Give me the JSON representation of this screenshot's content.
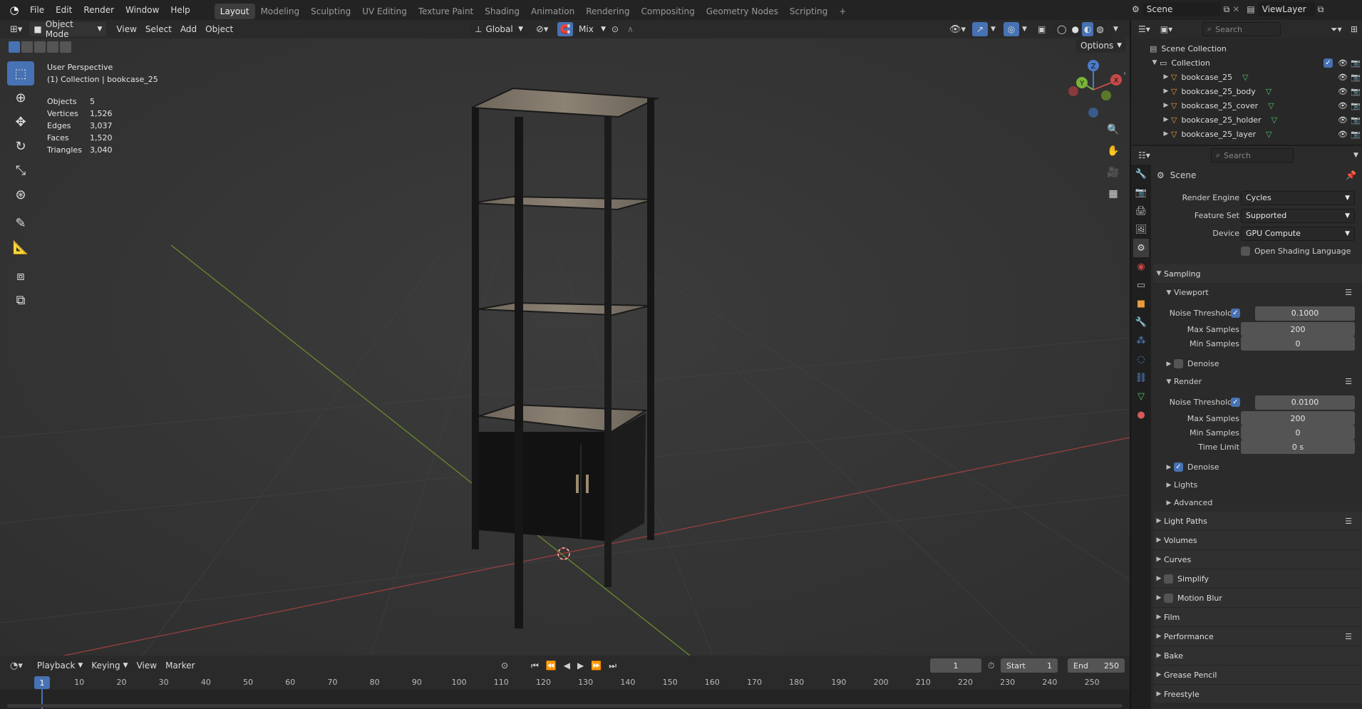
{
  "menu": [
    "File",
    "Edit",
    "Render",
    "Window",
    "Help"
  ],
  "workspaces": [
    "Layout",
    "Modeling",
    "Sculpting",
    "UV Editing",
    "Texture Paint",
    "Shading",
    "Animation",
    "Rendering",
    "Compositing",
    "Geometry Nodes",
    "Scripting"
  ],
  "active_workspace": "Layout",
  "scene_name": "Scene",
  "view_layer": "ViewLayer",
  "viewport_header": {
    "mode": "Object Mode",
    "view": "View",
    "select": "Select",
    "add": "Add",
    "object": "Object",
    "transform": "Global",
    "snap_mode": "Mix",
    "options": "Options"
  },
  "viewport_info": {
    "perspective": "User Perspective",
    "collection": "(1) Collection | bookcase_25"
  },
  "stats": [
    {
      "k": "Objects",
      "v": "5"
    },
    {
      "k": "Vertices",
      "v": "1,526"
    },
    {
      "k": "Edges",
      "v": "3,037"
    },
    {
      "k": "Faces",
      "v": "1,520"
    },
    {
      "k": "Triangles",
      "v": "3,040"
    }
  ],
  "gizmo": {
    "z": "Z",
    "y": "Y",
    "x": "X"
  },
  "outliner": {
    "search_placeholder": "Search",
    "root": "Scene Collection",
    "collection": "Collection",
    "objects": [
      "bookcase_25",
      "bookcase_25_body",
      "bookcase_25_cover",
      "bookcase_25_holder",
      "bookcase_25_layer"
    ]
  },
  "properties": {
    "search_placeholder": "Search",
    "context": "Scene",
    "render_engine_label": "Render Engine",
    "render_engine": "Cycles",
    "feature_set_label": "Feature Set",
    "feature_set": "Supported",
    "device_label": "Device",
    "device": "GPU Compute",
    "osl_label": "Open Shading Language",
    "sampling": "Sampling",
    "viewport": "Viewport",
    "noise_threshold_label": "Noise Threshold",
    "vp_noise": "0.1000",
    "max_samples_label": "Max Samples",
    "vp_max": "200",
    "min_samples_label": "Min Samples",
    "vp_min": "0",
    "denoise_label": "Denoise",
    "render": "Render",
    "r_noise": "0.0100",
    "r_max": "200",
    "r_min": "0",
    "time_limit_label": "Time Limit",
    "r_time": "0 s",
    "lights": "Lights",
    "advanced": "Advanced",
    "sections": [
      "Light Paths",
      "Volumes",
      "Curves",
      "Simplify",
      "Motion Blur",
      "Film",
      "Performance",
      "Bake",
      "Grease Pencil",
      "Freestyle"
    ]
  },
  "timeline": {
    "playback": "Playback",
    "keying": "Keying",
    "view": "View",
    "marker": "Marker",
    "current": "1",
    "start_label": "Start",
    "start": "1",
    "end_label": "End",
    "end": "250",
    "ticks": [
      "1",
      "10",
      "20",
      "30",
      "40",
      "50",
      "60",
      "70",
      "80",
      "90",
      "100",
      "110",
      "120",
      "130",
      "140",
      "150",
      "160",
      "170",
      "180",
      "190",
      "200",
      "210",
      "220",
      "230",
      "240",
      "250"
    ]
  }
}
